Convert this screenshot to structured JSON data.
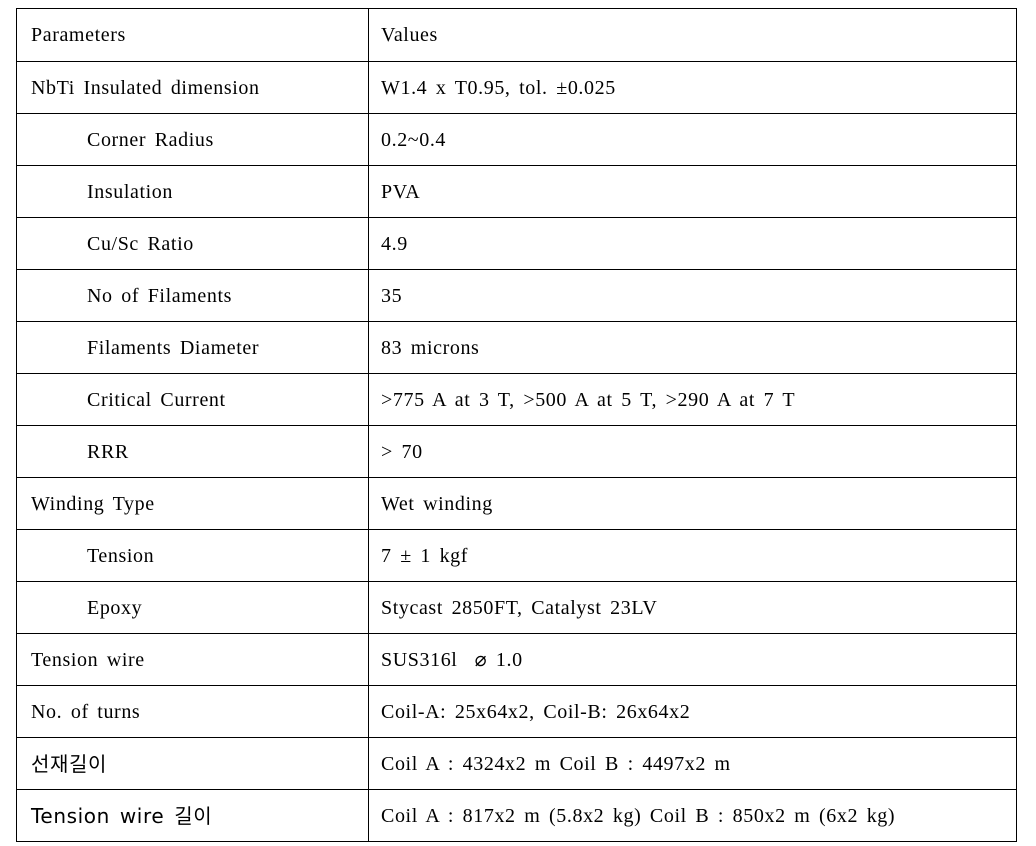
{
  "document": {
    "type": "specification-table",
    "title": "Superconducting magnet winding specification table"
  },
  "table": {
    "headers": {
      "parameters": "Parameters",
      "values": "Values"
    },
    "rows": [
      {
        "parameter": "NbTi Insulated dimension",
        "value": "W1.4 x T0.95, tol. ±0.025",
        "indent": false
      },
      {
        "parameter": "Corner Radius",
        "value": "0.2~0.4",
        "indent": true
      },
      {
        "parameter": "Insulation",
        "value": "PVA",
        "indent": true
      },
      {
        "parameter": "Cu/Sc Ratio",
        "value": "4.9",
        "indent": true
      },
      {
        "parameter": "No of Filaments",
        "value": "35",
        "indent": true
      },
      {
        "parameter": "Filaments Diameter",
        "value": "83 microns",
        "indent": true
      },
      {
        "parameter": "Critical Current",
        "value": ">775 A at 3 T, >500 A at 5 T, >290 A at 7 T",
        "indent": true
      },
      {
        "parameter": "RRR",
        "value": "> 70",
        "indent": true
      },
      {
        "parameter": "Winding Type",
        "value": "Wet winding",
        "indent": false
      },
      {
        "parameter": "Tension",
        "value": "7 ± 1 kgf",
        "indent": true
      },
      {
        "parameter": "Epoxy",
        "value": "Stycast 2850FT, Catalyst 23LV",
        "indent": true
      },
      {
        "parameter": "Tension wire",
        "value": "SUS316l  ⌀ 1.0",
        "indent": false
      },
      {
        "parameter": "No. of turns",
        "value": "Coil-A: 25x64x2, Coil-B: 26x64x2",
        "indent": false
      },
      {
        "parameter": "선재길이",
        "value": "Coil A : 4324x2 m Coil B : 4497x2 m",
        "indent": false,
        "korean": true
      },
      {
        "parameter": "Tension wire 길이",
        "value": "Coil A : 817x2 m (5.8x2 kg) Coil B : 850x2 m (6x2 kg)",
        "indent": false,
        "korean": true
      }
    ]
  },
  "style": {
    "border_color": "#000000",
    "text_color": "#000000",
    "background": "#ffffff"
  }
}
